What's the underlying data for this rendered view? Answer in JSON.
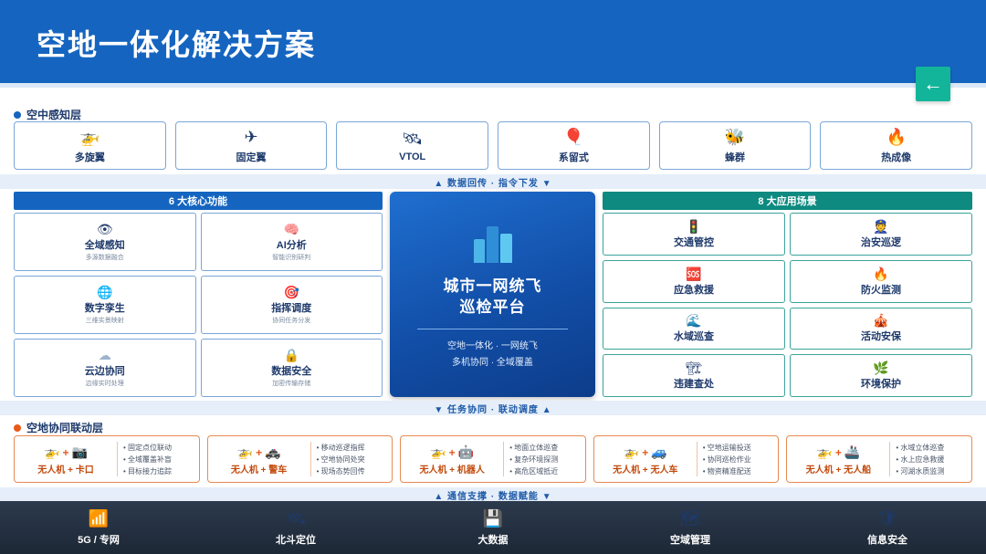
{
  "header": {
    "title": "空地一体化解决方案"
  },
  "back_button": {
    "icon": "arrow-left-icon",
    "glyph": "←"
  },
  "air_layer": {
    "title": "空中感知层",
    "items": [
      {
        "label": "多旋翼",
        "icon": "helicopter-icon",
        "glyph": "🚁"
      },
      {
        "label": "固定翼",
        "icon": "airplane-icon",
        "glyph": "✈"
      },
      {
        "label": "VTOL",
        "icon": "satellite-icon",
        "glyph": "🛰"
      },
      {
        "label": "系留式",
        "icon": "balloon-icon",
        "glyph": "🎈"
      },
      {
        "label": "蜂群",
        "icon": "bee-icon",
        "glyph": "🐝"
      },
      {
        "label": "热成像",
        "icon": "fire-icon",
        "glyph": "🔥"
      }
    ]
  },
  "band_top": "▲ 数据回传 · 指令下发 ▼",
  "core": {
    "title": "6 大核心功能",
    "items": [
      {
        "label": "全域感知",
        "sub": "多源数据融合",
        "icon": "eye-icon",
        "glyph": "👁"
      },
      {
        "label": "AI分析",
        "sub": "智能识别研判",
        "icon": "brain-icon",
        "glyph": "🧠"
      },
      {
        "label": "数字孪生",
        "sub": "三维实景映射",
        "icon": "globe-icon",
        "glyph": "🌐"
      },
      {
        "label": "指挥调度",
        "sub": "协同任务分发",
        "icon": "target-icon",
        "glyph": "🎯"
      },
      {
        "label": "云边协同",
        "sub": "边缘实时处理",
        "icon": "cloud-icon",
        "glyph": "☁"
      },
      {
        "label": "数据安全",
        "sub": "加密传输存储",
        "icon": "lock-icon",
        "glyph": "🔒"
      }
    ]
  },
  "center": {
    "title_line1": "城市一网统飞",
    "title_line2": "巡检平台",
    "tagline1": "空地一体化 · 一网统飞",
    "tagline2": "多机协同 · 全域覆盖"
  },
  "apps": {
    "title": "8 大应用场景",
    "items": [
      {
        "label": "交通管控",
        "icon": "traffic-light-icon",
        "glyph": "🚦"
      },
      {
        "label": "治安巡逻",
        "icon": "police-officer-icon",
        "glyph": "👮"
      },
      {
        "label": "应急救援",
        "icon": "sos-icon",
        "glyph": "🆘"
      },
      {
        "label": "防火监测",
        "icon": "fire-icon",
        "glyph": "🔥"
      },
      {
        "label": "水域巡查",
        "icon": "wave-icon",
        "glyph": "🌊"
      },
      {
        "label": "活动安保",
        "icon": "tent-icon",
        "glyph": "🎪"
      },
      {
        "label": "违建查处",
        "icon": "construction-icon",
        "glyph": "🏗"
      },
      {
        "label": "环境保护",
        "icon": "leaf-icon",
        "glyph": "🌿"
      }
    ]
  },
  "band_mid": "▼ 任务协同 · 联动调度 ▲",
  "coop_layer": {
    "title": "空地协同联动层",
    "items": [
      {
        "label": "无人机 + 卡口",
        "icon_a": "helicopter-icon",
        "glyph_a": "🚁",
        "icon_b": "camera-icon",
        "glyph_b": "📷",
        "lines": [
          "• 固定点位联动",
          "• 全域覆盖补盲",
          "• 目标接力追踪"
        ]
      },
      {
        "label": "无人机 + 警车",
        "icon_a": "helicopter-icon",
        "glyph_a": "🚁",
        "icon_b": "police-car-icon",
        "glyph_b": "🚓",
        "lines": [
          "• 移动巡逻指挥",
          "• 空地协同处突",
          "• 现场态势回传"
        ]
      },
      {
        "label": "无人机 + 机器人",
        "icon_a": "helicopter-icon",
        "glyph_a": "🚁",
        "icon_b": "robot-icon",
        "glyph_b": "🤖",
        "lines": [
          "• 地面立体巡查",
          "• 复杂环境探测",
          "• 高危区域抵近"
        ]
      },
      {
        "label": "无人机 + 无人车",
        "icon_a": "helicopter-icon",
        "glyph_a": "🚁",
        "icon_b": "car-icon",
        "glyph_b": "🚙",
        "lines": [
          "• 空地运输投送",
          "• 协同巡检作业",
          "• 物资精准配送"
        ]
      },
      {
        "label": "无人机 + 无人船",
        "icon_a": "helicopter-icon",
        "glyph_a": "🚁",
        "icon_b": "ship-icon",
        "glyph_b": "🚢",
        "lines": [
          "• 水域立体巡查",
          "• 水上应急救援",
          "• 河湖水质监测"
        ]
      }
    ]
  },
  "band_bottom": "▲ 通信支撑 · 数据赋能 ▼",
  "footer": {
    "items": [
      {
        "label": "5G / 专网",
        "icon": "signal-bars-icon",
        "glyph": "📶"
      },
      {
        "label": "北斗定位",
        "icon": "satellite-icon",
        "glyph": "🛰"
      },
      {
        "label": "大数据",
        "icon": "floppy-disk-icon",
        "glyph": "💾"
      },
      {
        "label": "空域管理",
        "icon": "map-icon",
        "glyph": "🗺"
      },
      {
        "label": "信息安全",
        "icon": "shield-icon",
        "glyph": "🛡"
      }
    ]
  }
}
